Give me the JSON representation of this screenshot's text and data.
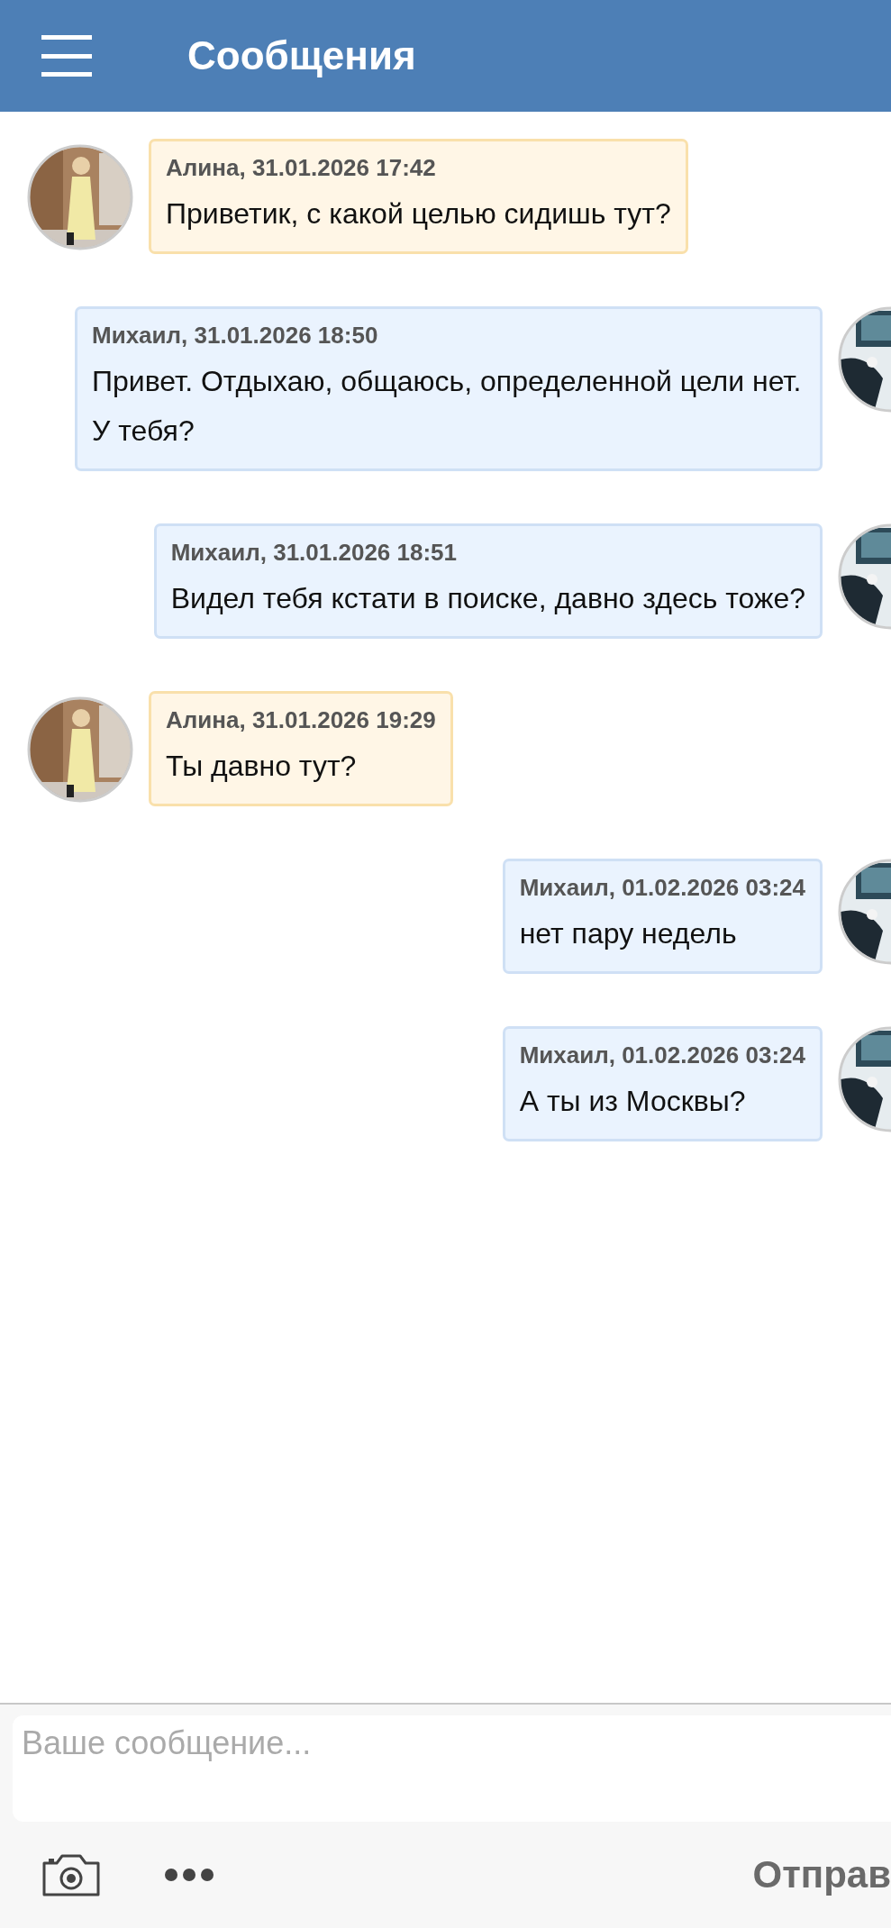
{
  "header": {
    "title": "Сообщения"
  },
  "messages": [
    {
      "kind": "incoming",
      "meta": "Алина, 31.01.2026 17:42",
      "text": "Приветик, с какой целью сидишь тут?"
    },
    {
      "kind": "outgoing",
      "meta": "Михаил, 31.01.2026 18:50",
      "text": "Привет. Отдыхаю, общаюсь, определенной цели нет. У тебя?"
    },
    {
      "kind": "outgoing",
      "meta": "Михаил, 31.01.2026 18:51",
      "text": "Видел тебя кстати в поиске, давно здесь тоже?"
    },
    {
      "kind": "incoming",
      "meta": "Алина, 31.01.2026 19:29",
      "text": "Ты давно тут?"
    },
    {
      "kind": "outgoing",
      "meta": "Михаил, 01.02.2026 03:24",
      "text": "нет пару недель"
    },
    {
      "kind": "outgoing",
      "meta": "Михаил, 01.02.2026 03:24",
      "text": "А ты из Москвы?"
    }
  ],
  "composer": {
    "placeholder": "Ваше сообщение...",
    "send_label": "Отправ"
  }
}
